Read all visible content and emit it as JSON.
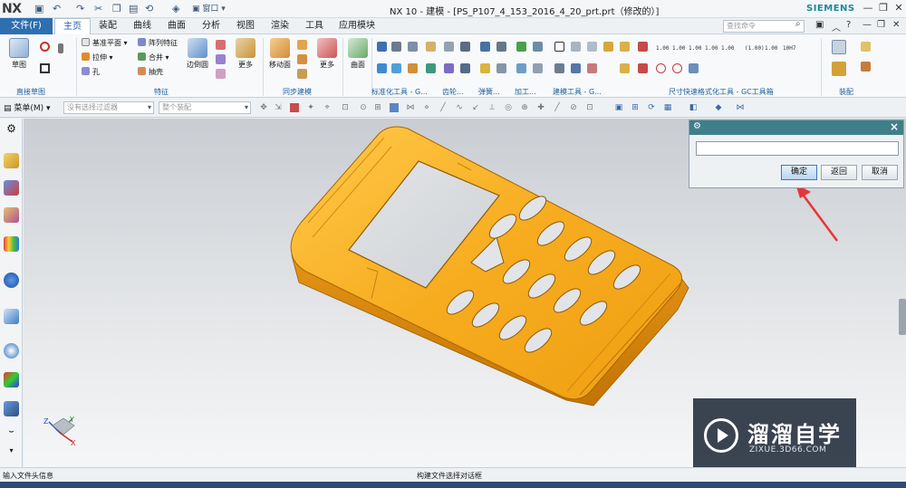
{
  "app": {
    "logo": "NX",
    "title": "NX 10 - 建模 - [PS_P107_4_153_2016_4_20_prt.prt（修改的）]",
    "brand": "SIEMENS",
    "window_menu_label": "窗口"
  },
  "tabs": [
    {
      "label": "文件(F)"
    },
    {
      "label": "主页"
    },
    {
      "label": "装配"
    },
    {
      "label": "曲线"
    },
    {
      "label": "曲面"
    },
    {
      "label": "分析"
    },
    {
      "label": "视图"
    },
    {
      "label": "渲染"
    },
    {
      "label": "工具"
    },
    {
      "label": "应用模块"
    }
  ],
  "search": {
    "placeholder": "查找命令"
  },
  "ribbon": {
    "groups": [
      {
        "label": "直接草图"
      },
      {
        "label": "特征"
      },
      {
        "label": "同步建模"
      },
      {
        "label": "标准化工具 - G..."
      },
      {
        "label": "齿轮..."
      },
      {
        "label": "弹簧..."
      },
      {
        "label": "加工..."
      },
      {
        "label": "建模工具 - G..."
      },
      {
        "label": "尺寸快速格式化工具 - GC工具箱"
      },
      {
        "label": "装配"
      }
    ],
    "buttons": {
      "sketch": "草图",
      "datum_plane": "基准平面",
      "pattern_feature": "阵列特征",
      "extrude": "拉伸",
      "unite": "合并",
      "hole": "孔",
      "shell": "抽壳",
      "edge_blend": "边倒圆",
      "more1": "更多",
      "move_face": "移动面",
      "more2": "更多",
      "surface": "曲面",
      "more3": "更多"
    },
    "dim_labels": [
      "1.00",
      "1.00",
      "1.00",
      "1.00",
      "1.00",
      "(1.00)",
      "1.00",
      "10H7"
    ]
  },
  "toolbar": {
    "menu_label": "菜单(M)",
    "filter_placeholder": "没有选择过滤器",
    "assembly_placeholder": "整个装配"
  },
  "dialog": {
    "ok": "确定",
    "back": "返回",
    "cancel": "取消",
    "input_value": ""
  },
  "axes": {
    "x": "X",
    "y": "Y",
    "z": "Z"
  },
  "watermark": {
    "title": "溜溜自学",
    "url": "ZIXUE.3D66.COM"
  },
  "status": {
    "left": "输入文件头信息",
    "center": "构建文件选择对话框"
  },
  "colors": {
    "model": "#f5a623",
    "accent": "#2d6fb0",
    "dialog_header": "#3e7f8a",
    "arrow": "#e8343b"
  }
}
